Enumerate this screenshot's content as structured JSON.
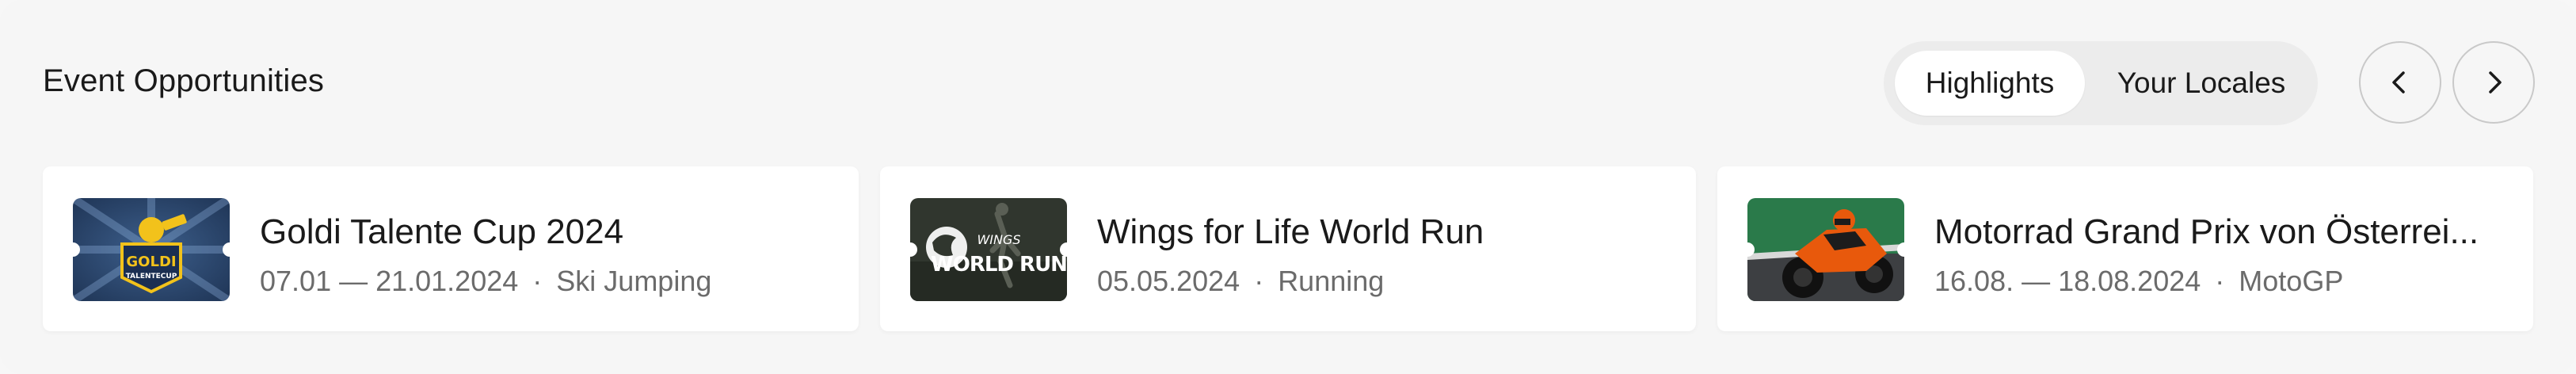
{
  "section": {
    "title": "Event Opportunities"
  },
  "tabs": [
    {
      "label": "Highlights",
      "active": true
    },
    {
      "label": "Your Locales",
      "active": false
    }
  ],
  "nav": {
    "prev_icon": "chevron-left-icon",
    "next_icon": "chevron-right-icon"
  },
  "events": [
    {
      "title": "Goldi Talente Cup 2024",
      "dates": "07.01 — 21.01.2024",
      "sport": "Ski Jumping",
      "logo_text_1": "GOLDI",
      "logo_text_2": "TALENTECUP"
    },
    {
      "title": "Wings for Life World Run",
      "dates": "05.05.2024",
      "sport": "Running",
      "logo_text_1": "WINGS",
      "logo_text_2": "WORLD RUN"
    },
    {
      "title": "Motorrad Grand Prix von Österrei...",
      "dates": "16.08. — 18.08.2024",
      "sport": "MotoGP"
    }
  ],
  "separator": "·",
  "colors": {
    "background": "#f6f6f6",
    "card": "#ffffff",
    "meta_text": "#6b6b6b",
    "tab_track": "#ececec"
  }
}
